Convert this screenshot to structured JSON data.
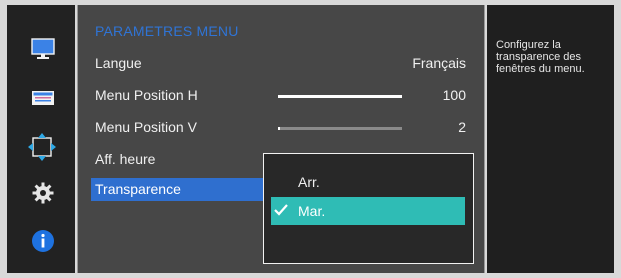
{
  "menu": {
    "title": "PARAMETRES MENU",
    "rows": [
      {
        "label": "Langue",
        "value": "Français"
      },
      {
        "label": "Menu Position H",
        "value": "100",
        "level": 100
      },
      {
        "label": "Menu Position V",
        "value": "2",
        "level": 2
      },
      {
        "label": "Aff. heure",
        "value": ""
      },
      {
        "label": "Transparence",
        "value": ""
      }
    ],
    "selected_row": "Transparence"
  },
  "popup": {
    "options": [
      {
        "label": "Arr.",
        "checked": false
      },
      {
        "label": "Mar.",
        "checked": true
      }
    ]
  },
  "help": {
    "text": "Configurez la transparence des fenêtres du menu."
  },
  "sidebar": {
    "icons": [
      "picture-icon",
      "onscreen-display-icon",
      "position-size-icon",
      "settings-gear-icon",
      "info-icon"
    ],
    "active_icon": "position-size-icon"
  },
  "colors": {
    "title_blue": "#2f74d6",
    "selected_row_blue": "#2f6fcf",
    "option_teal": "#2fbcb5",
    "info_blue": "#1e72e0"
  }
}
